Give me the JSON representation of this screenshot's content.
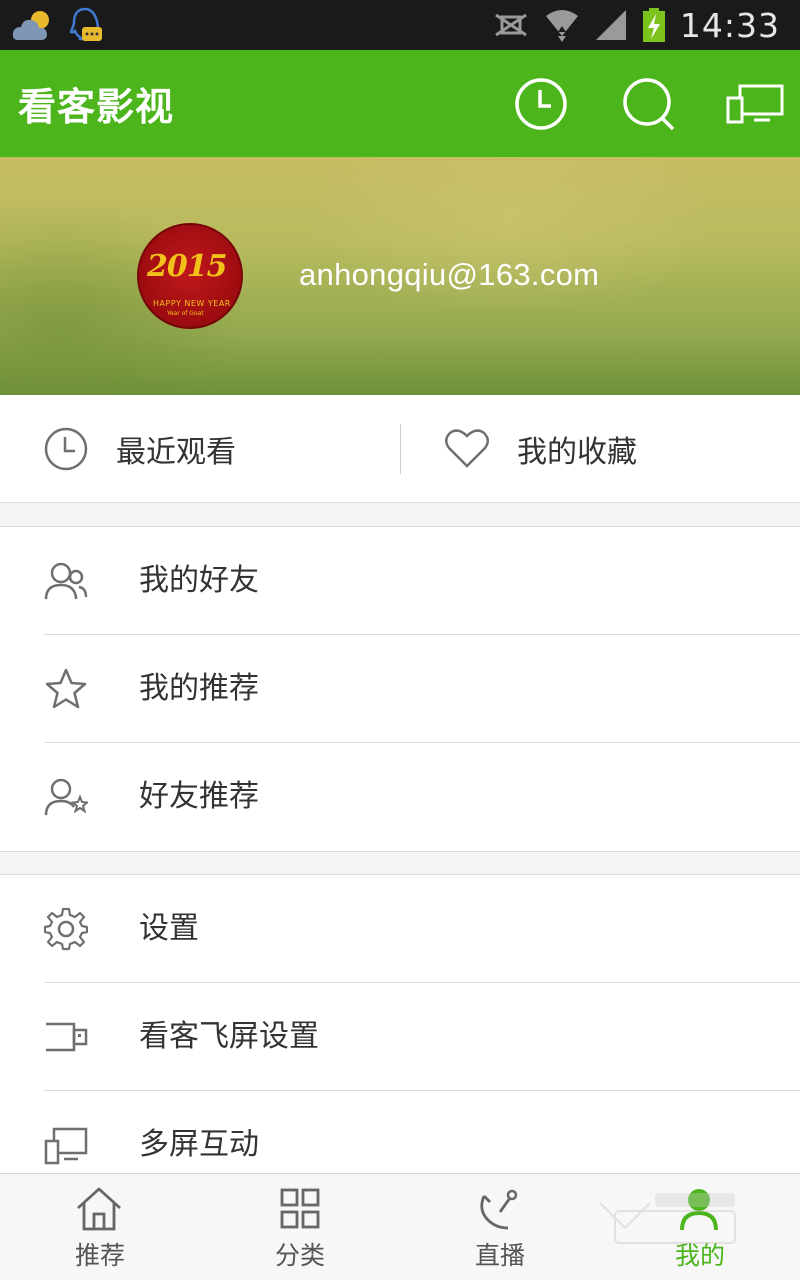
{
  "status_bar": {
    "time": "14:33",
    "icons": [
      "weather-cloud-icon",
      "qq-message-icon",
      "silent-icon",
      "wifi-icon",
      "signal-icon",
      "battery-charging-icon"
    ]
  },
  "app_bar": {
    "title": "看客影视",
    "icons": [
      "history-icon",
      "search-icon",
      "screen-cast-icon"
    ]
  },
  "profile": {
    "avatar_text": "2015",
    "avatar_subtext": "HAPPY NEW YEAR",
    "avatar_subtext2": "Year of Goat",
    "email": "anhongqiu@163.com"
  },
  "quick_actions": [
    {
      "label": "最近观看",
      "icon": "clock-icon"
    },
    {
      "label": "我的收藏",
      "icon": "heart-icon"
    }
  ],
  "menu_group_1": [
    {
      "label": "我的好友",
      "icon": "friends-icon"
    },
    {
      "label": "我的推荐",
      "icon": "star-icon"
    },
    {
      "label": "好友推荐",
      "icon": "user-star-icon"
    }
  ],
  "menu_group_2": [
    {
      "label": "设置",
      "icon": "gear-icon"
    },
    {
      "label": "看客飞屏设置",
      "icon": "usb-icon"
    },
    {
      "label": "多屏互动",
      "icon": "multi-screen-icon"
    }
  ],
  "bottom_nav": [
    {
      "label": "推荐",
      "icon": "home-icon",
      "active": false
    },
    {
      "label": "分类",
      "icon": "grid-icon",
      "active": false
    },
    {
      "label": "直播",
      "icon": "live-icon",
      "active": false
    },
    {
      "label": "我的",
      "icon": "profile-icon",
      "active": true
    }
  ],
  "colors": {
    "accent": "#4cb51c",
    "status_bar": "#1a1a1a",
    "text": "#333333",
    "icon_gray": "#6f6f6f"
  }
}
